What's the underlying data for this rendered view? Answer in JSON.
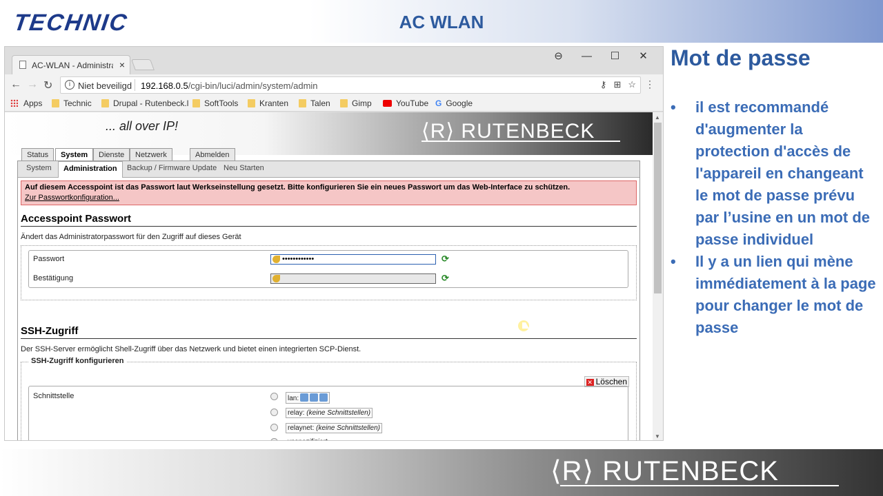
{
  "header": {
    "logo_text": "TECHNIC",
    "title": "AC WLAN"
  },
  "browser": {
    "tab_title": "AC-WLAN - Administratio",
    "tab_close": "×",
    "window_controls": [
      "⊖",
      "—",
      "☐",
      "✕"
    ],
    "nav": {
      "back": "←",
      "forward": "→",
      "reload": "↻"
    },
    "security_label": "Niet beveiligd",
    "url_host": "192.168.0.5",
    "url_path": "/cgi-bin/luci/admin/system/admin",
    "bookmarks": [
      "Apps",
      "Technic",
      "Drupal - Rutenbeck.l",
      "SoftTools",
      "Kranten",
      "Talen",
      "Gimp",
      "YouTube",
      "Google"
    ]
  },
  "page": {
    "tagline": "... all over IP!",
    "brand_logo": "⟨R⟩  RUTENBECK",
    "main_tabs": [
      "Status",
      "System",
      "Dienste",
      "Netzwerk",
      "Abmelden"
    ],
    "sub_tabs": [
      "System",
      "Administration",
      "Backup / Firmware Update",
      "Neu Starten"
    ],
    "warning_text": "Auf diesem Accesspoint ist das Passwort laut Werkseinstellung gesetzt. Bitte konfigurieren Sie ein neues Passwort um das Web-Interface zu schützen.",
    "warning_link": "Zur Passwortkonfiguration...",
    "password_section": {
      "title": "Accesspoint Passwort",
      "description": "Ändert das Administratorpasswort für den Zugriff auf dieses Gerät",
      "password_label": "Passwort",
      "password_value": "••••••••••••",
      "confirm_label": "Bestätigung",
      "confirm_value": ""
    },
    "ssh_section": {
      "title": "SSH-Zugriff",
      "description": "Der SSH-Server ermöglicht Shell-Zugriff über das Netzwerk und bietet einen integrierten SCP-Dienst.",
      "legend": "SSH-Zugriff konfigurieren",
      "delete_label": "Löschen",
      "interface_label": "Schnittstelle",
      "options": [
        {
          "label": "lan:",
          "note": ""
        },
        {
          "label": "relay:",
          "note": "(keine Schnittstellen)"
        },
        {
          "label": "relaynet:",
          "note": "(keine Schnittstellen)"
        },
        {
          "label": "unspezifiziert",
          "note": ""
        }
      ]
    }
  },
  "side": {
    "title": "Mot de passe",
    "bullets": [
      "il est recommandé d'augmenter la protection d'accès de l'appareil en changeant le mot de passe prévu par l’usine en un mot de passe individuel",
      "Il y a un lien qui mène immédiatement à la page pour changer le mot de passe"
    ]
  },
  "footer": {
    "brand_logo": "⟨R⟩  RUTENBECK"
  }
}
